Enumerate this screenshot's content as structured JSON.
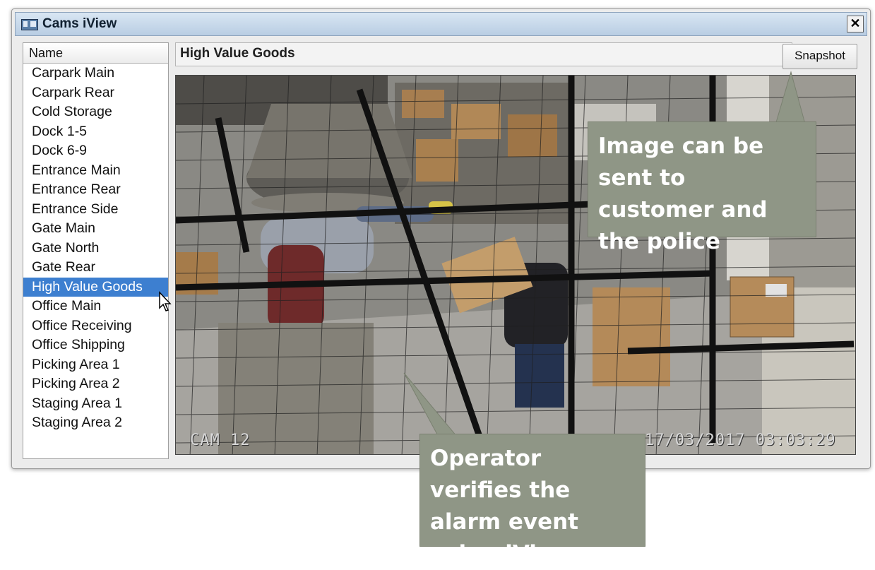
{
  "window": {
    "title": "Cams iView",
    "close_label": "✕"
  },
  "camera_list": {
    "header": "Name",
    "items": [
      "Carpark Main",
      "Carpark Rear",
      "Cold Storage",
      "Dock 1-5",
      "Dock 6-9",
      "Entrance Main",
      "Entrance Rear",
      "Entrance Side",
      "Gate Main",
      "Gate North",
      "Gate Rear",
      "High Value Goods",
      "Office Main",
      "Office Receiving",
      "Office Shipping",
      "Picking Area 1",
      "Picking Area 2",
      "Staging Area 1",
      "Staging Area 2"
    ],
    "selected": "High Value Goods"
  },
  "viewer": {
    "camera_name": "High Value Goods",
    "snapshot_label": "Snapshot",
    "osd_camera": "CAM 12",
    "osd_timestamp": "17/03/2017 03:03:29"
  },
  "callouts": {
    "snapshot": "Image can be sent to customer and the police",
    "verify": "Operator verifies the alarm event using iView"
  },
  "colors": {
    "selection": "#3d7fd0",
    "callout": "#8f9686",
    "titlebar": "#c7d8ea"
  }
}
